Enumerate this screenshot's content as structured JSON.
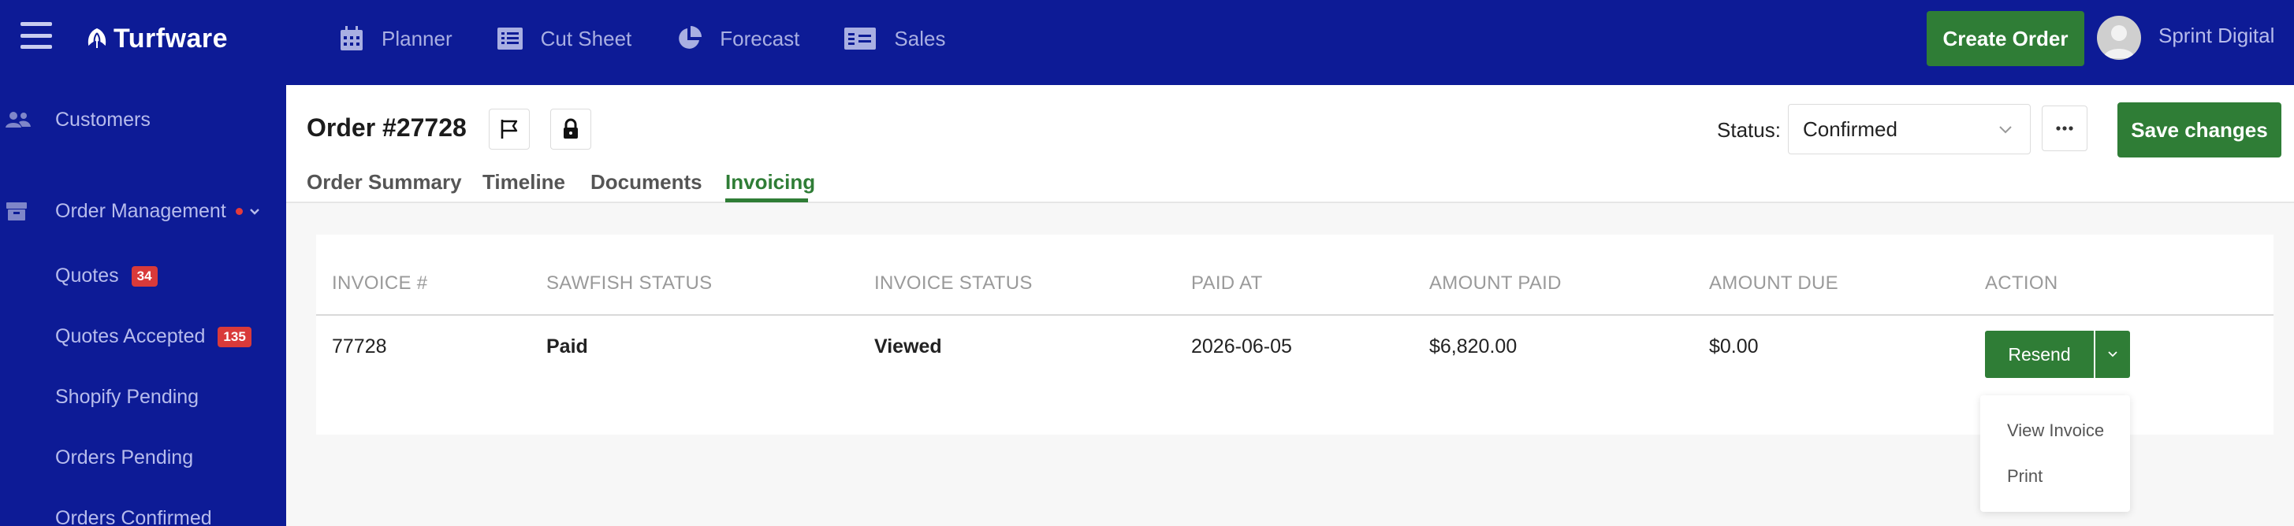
{
  "app": {
    "name": "Turfware"
  },
  "nav": [
    {
      "label": "Planner",
      "icon": "calendar-icon"
    },
    {
      "label": "Cut Sheet",
      "icon": "list-icon"
    },
    {
      "label": "Forecast",
      "icon": "pie-chart-icon"
    },
    {
      "label": "Sales",
      "icon": "id-card-icon"
    }
  ],
  "header": {
    "create_order_label": "Create Order",
    "user_name": "Sprint Digital"
  },
  "sidebar": {
    "items": [
      {
        "label": "Customers",
        "icon": "users-icon"
      },
      {
        "label": "Order Management",
        "icon": "box-icon"
      },
      {
        "label": "Quotes",
        "badge": "34"
      },
      {
        "label": "Quotes Accepted",
        "badge": "135"
      },
      {
        "label": "Shopify Pending"
      },
      {
        "label": "Orders Pending"
      },
      {
        "label": "Orders Confirmed"
      }
    ]
  },
  "order": {
    "title": "Order #27728",
    "status_label": "Status:",
    "status_value": "Confirmed",
    "save_label": "Save changes",
    "tabs": [
      {
        "label": "Order Summary"
      },
      {
        "label": "Timeline"
      },
      {
        "label": "Documents"
      },
      {
        "label": "Invoicing",
        "active": true
      }
    ]
  },
  "invoices": {
    "columns": [
      "INVOICE #",
      "SAWFISH STATUS",
      "INVOICE STATUS",
      "PAID AT",
      "AMOUNT PAID",
      "AMOUNT DUE",
      "ACTION"
    ],
    "rows": [
      {
        "invoice_no": "77728",
        "sawfish_status": "Paid",
        "invoice_status": "Viewed",
        "paid_at": "2026-06-05",
        "amount_paid": "$6,820.00",
        "amount_due": "$0.00",
        "action_label": "Resend"
      }
    ],
    "action_menu": [
      "View Invoice",
      "Print"
    ]
  },
  "colors": {
    "brand_navy": "#0d1b96",
    "accent_green": "#2f7d36",
    "badge_red": "#d93a3a"
  }
}
